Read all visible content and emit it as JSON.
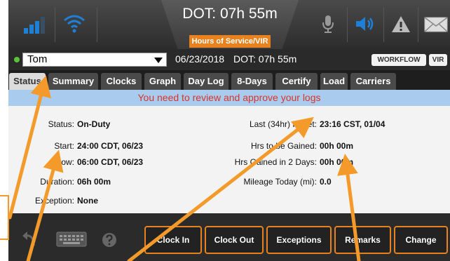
{
  "header": {
    "title": "DOT: 07h 55m",
    "badge": "Hours of Service/VIR"
  },
  "driver_row": {
    "driver": "Tom",
    "date": "06/23/2018",
    "dot": "DOT: 07h 55m",
    "workflow_label": "WORKFLOW",
    "vir_label": "VIR"
  },
  "tabs": [
    "Status",
    "Summary",
    "Clocks",
    "Graph",
    "Day Log",
    "8-Days",
    "Certify",
    "Load",
    "Carriers"
  ],
  "banner": "You need to review and approve your logs",
  "left": {
    "status_label": "Status:",
    "status_value": "On-Duty",
    "start_label": "Start:",
    "start_value": "24:00 CDT, 06/23",
    "now_label": "Now:",
    "now_value": "06:00 CDT, 06/23",
    "duration_label": "Duration:",
    "duration_value": "06h 00m",
    "exception_label": "Exception:",
    "exception_value": "None"
  },
  "right": {
    "last_reset_label": "Last (34hr) Reset:",
    "last_reset_value": "23:16 CST, 01/04",
    "hrs_gained_label": "Hrs to be Gained:",
    "hrs_gained_value": "00h 00m",
    "hrs_gained2_label": "Hrs Gained in 2 Days:",
    "hrs_gained2_value": "00h 00m",
    "mileage_label": "Mileage Today (mi):",
    "mileage_value": "0.0"
  },
  "actions": {
    "clock_in": "Clock In",
    "clock_out": "Clock Out",
    "exceptions": "Exceptions",
    "remarks": "Remarks",
    "change": "Change"
  },
  "colors": {
    "accent": "#e8821e",
    "banner_bg": "#a9cbed",
    "banner_text": "#d9342b",
    "icon_blue": "#1e7fd6"
  },
  "icons": [
    "signal-icon",
    "wifi-icon",
    "microphone-icon",
    "speaker-icon",
    "warning-icon",
    "mail-icon",
    "back-icon",
    "keyboard-icon",
    "help-icon"
  ]
}
